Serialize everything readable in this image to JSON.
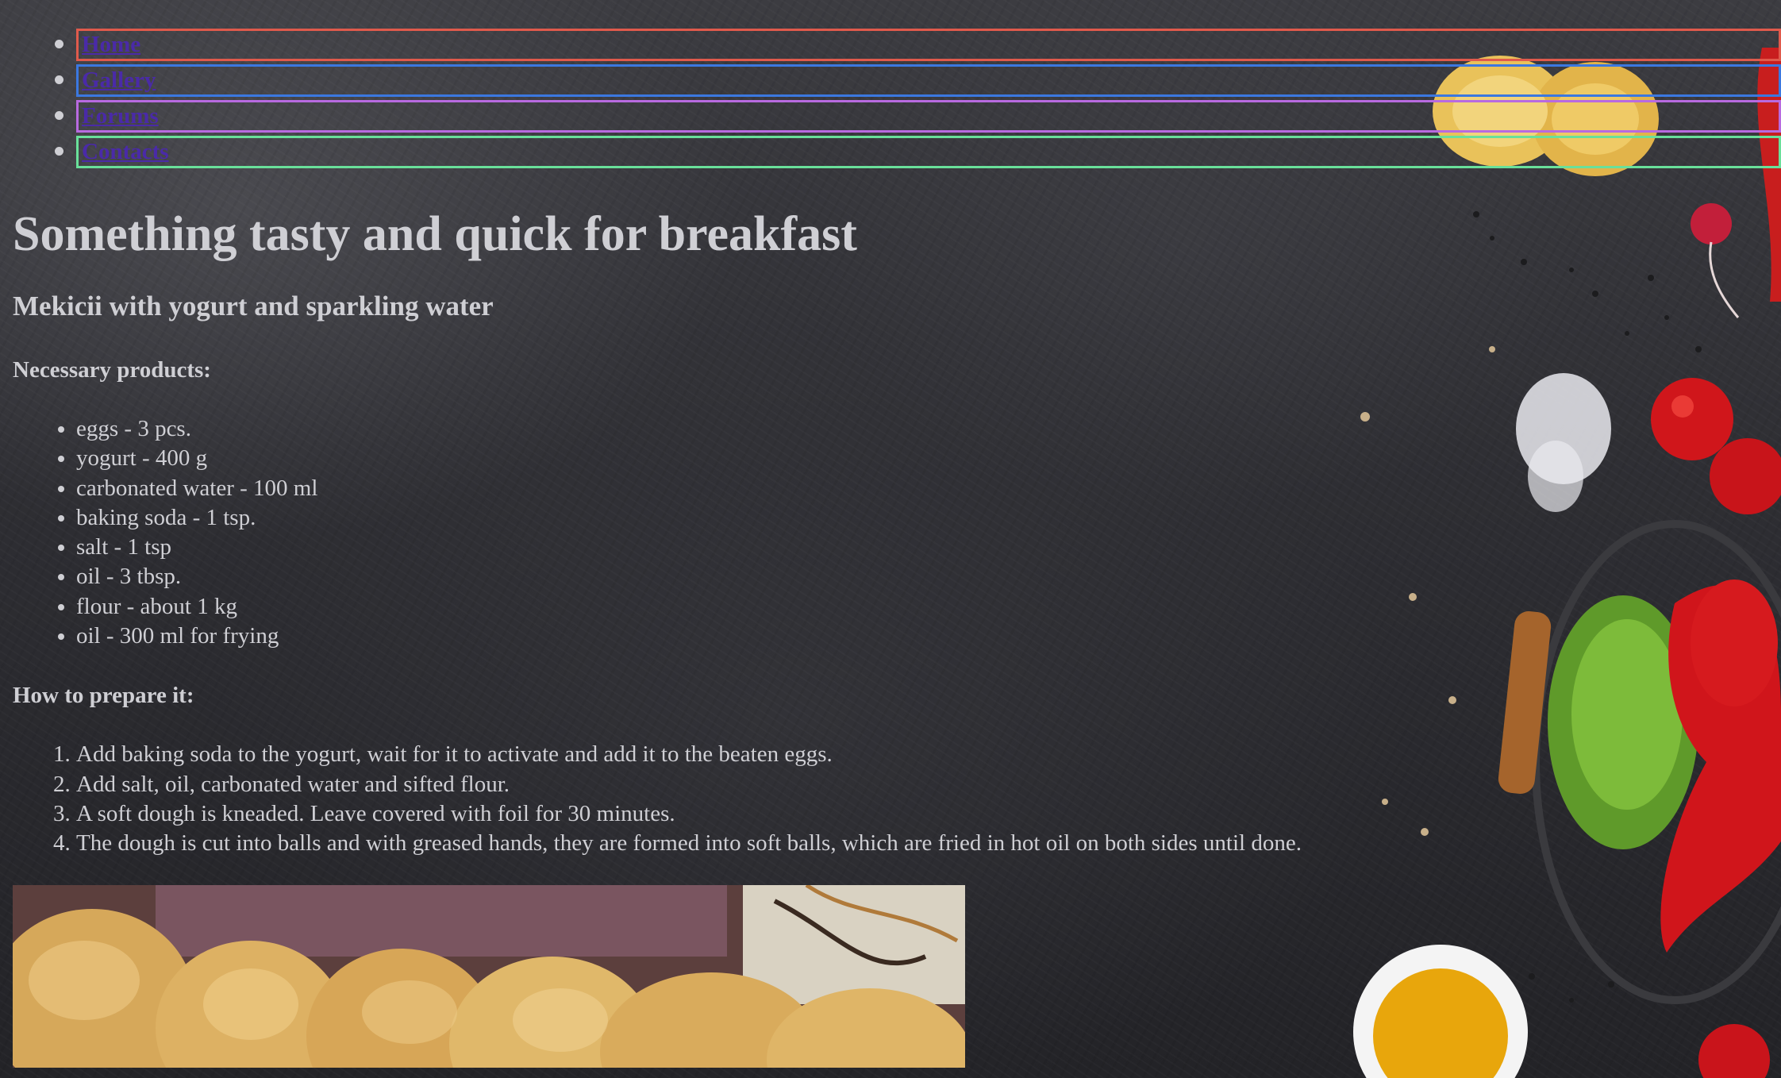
{
  "nav": {
    "items": [
      {
        "label": "Home"
      },
      {
        "label": "Gallery"
      },
      {
        "label": "Forums"
      },
      {
        "label": "Contacts"
      }
    ]
  },
  "recipe": {
    "title": "Something tasty and quick for breakfast",
    "subtitle": "Mekicii with yogurt and sparkling water",
    "products_heading": "Necessary products:",
    "products": [
      "eggs - 3 pcs.",
      "yogurt - 400 g",
      "carbonated water - 100 ml",
      "baking soda - 1 tsp.",
      "salt - 1 tsp",
      "oil - 3 tbsp.",
      "flour - about 1 kg",
      "oil - 300 ml for frying"
    ],
    "steps_heading": "How to prepare it:",
    "steps": [
      "Add baking soda to the yogurt, wait for it to activate and add it to the beaten eggs.",
      "Add salt, oil, carbonated water and sifted flour.",
      "A soft dough is kneaded. Leave covered with foil for 30 minutes.",
      "The dough is cut into balls and with greased hands, they are formed into soft balls, which are fried in hot oil on both sides until done."
    ]
  },
  "colors": {
    "text": "#cfcfd4",
    "link": "#4a2aa8",
    "background": "#2e2e33"
  },
  "icons": {
    "nav_bullet": "disc-bullet"
  }
}
